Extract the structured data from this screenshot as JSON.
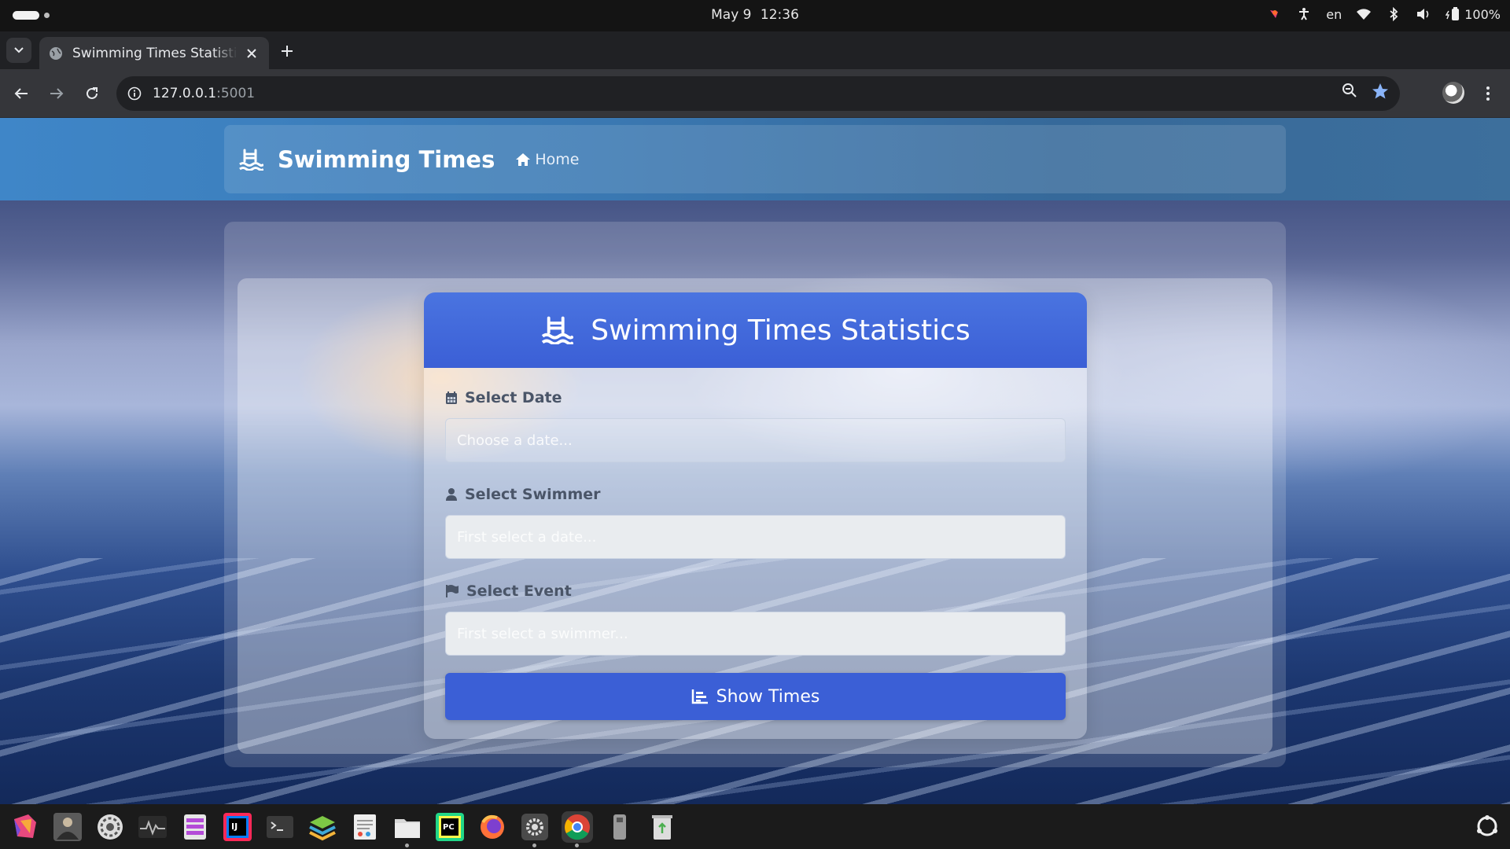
{
  "os": {
    "date": "May 9",
    "time": "12:36",
    "language": "en",
    "battery": "100%"
  },
  "browser": {
    "tab_title": "Swimming Times Statistics",
    "url_host": "127.0.0.1",
    "url_port": ":5001"
  },
  "navbar": {
    "brand": "Swimming Times",
    "home_label": "Home"
  },
  "form": {
    "title": "Swimming Times Statistics",
    "date_label": "Select Date",
    "date_placeholder": "Choose a date...",
    "swimmer_label": "Select Swimmer",
    "swimmer_placeholder": "First select a date...",
    "event_label": "Select Event",
    "event_placeholder": "First select a swimmer...",
    "submit_label": "Show Times"
  },
  "dock": {
    "apps": [
      "app-launcher-icon",
      "photo-app-icon",
      "settings-dial-icon",
      "system-monitor-icon",
      "database-icon",
      "intellij-icon",
      "terminal-icon",
      "layers-app-icon",
      "text-editor-icon",
      "files-icon",
      "pycharm-icon",
      "firefox-icon",
      "settings-icon",
      "chrome-icon",
      "usb-drive-icon",
      "trash-icon"
    ]
  },
  "colors": {
    "header_blue": "#3b5fd6",
    "navbar_blue": "#3a78b2"
  }
}
